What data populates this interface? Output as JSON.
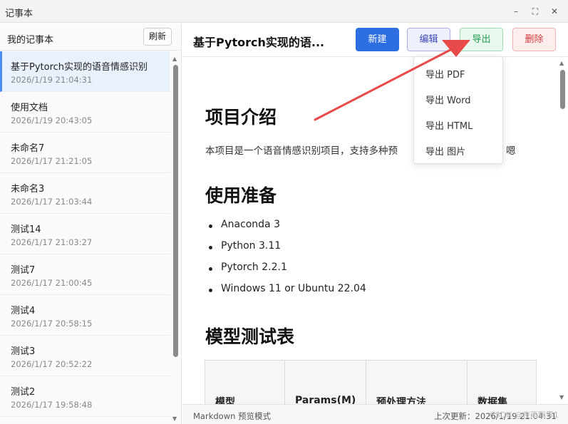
{
  "window": {
    "title": "记事本",
    "minimize_glyph": "–",
    "maximize_glyph": "⛶",
    "close_glyph": "✕"
  },
  "sidebar": {
    "label": "我的记事本",
    "refresh_label": "刷新",
    "items": [
      {
        "title": "基于Pytorch实现的语音情感识别",
        "time": "2026/1/19 21:04:31"
      },
      {
        "title": "使用文档",
        "time": "2026/1/19 20:43:05"
      },
      {
        "title": "未命名7",
        "time": "2026/1/17 21:21:05"
      },
      {
        "title": "未命名3",
        "time": "2026/1/17 21:03:44"
      },
      {
        "title": "测试14",
        "time": "2026/1/17 21:03:27"
      },
      {
        "title": "测试7",
        "time": "2026/1/17 21:00:45"
      },
      {
        "title": "测试4",
        "time": "2026/1/17 20:58:15"
      },
      {
        "title": "测试3",
        "time": "2026/1/17 20:52:22"
      },
      {
        "title": "测试2",
        "time": "2026/1/17 19:58:48"
      }
    ]
  },
  "header": {
    "title": "基于Pytorch实现的语...",
    "new_label": "新建",
    "edit_label": "编辑",
    "export_label": "导出",
    "delete_label": "删除"
  },
  "export_menu": {
    "items": [
      "导出 PDF",
      "导出 Word",
      "导出 HTML",
      "导出 图片"
    ]
  },
  "content": {
    "h1_intro": "项目介绍",
    "intro_text": "本项目是一个语音情感识别项目，支持多种预",
    "intro_tail": "嗯",
    "h1_prep": "使用准备",
    "prep_items": [
      "Anaconda 3",
      "Python 3.11",
      "Pytorch 2.2.1",
      "Windows 11 or Ubuntu 22.04"
    ],
    "h1_table": "模型测试表",
    "table_headers": [
      "模型",
      "Params(M)",
      "预处理方法",
      "数据集"
    ]
  },
  "footer": {
    "mode": "Markdown 预览模式",
    "updated": "上次更新：2026/1/19 21:04:31",
    "watermark": "CSDN @夜雨飘零1"
  },
  "colors": {
    "accent": "#2d6fe0",
    "annotation_arrow": "#e84a4a"
  }
}
